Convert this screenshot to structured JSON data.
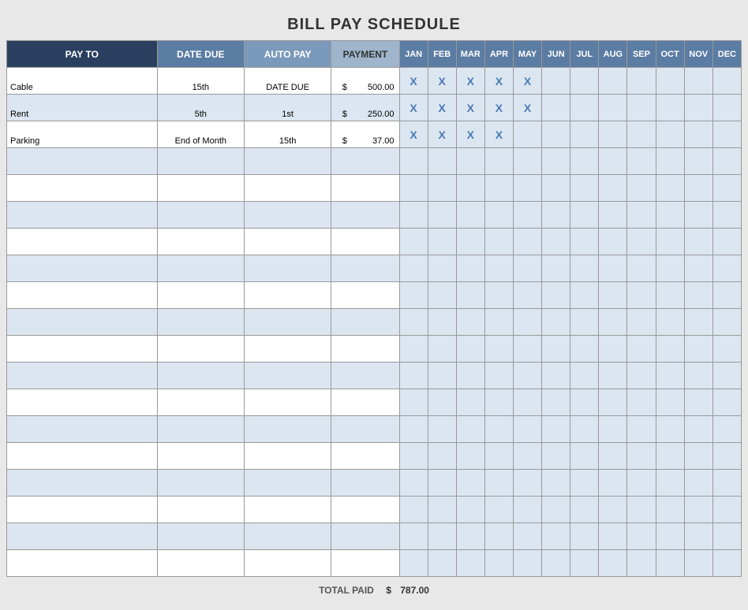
{
  "title": "BILL PAY SCHEDULE",
  "headers": {
    "payto": "PAY TO",
    "datedue": "DATE DUE",
    "autopay": "AUTO PAY",
    "payment": "PAYMENT",
    "months": [
      "JAN",
      "FEB",
      "MAR",
      "APR",
      "MAY",
      "JUN",
      "JUL",
      "AUG",
      "SEP",
      "OCT",
      "NOV",
      "DEC"
    ]
  },
  "currency_symbol": "$",
  "rows": [
    {
      "payto": "Cable",
      "datedue": "15th",
      "autopay": "DATE DUE",
      "payment": "500.00",
      "months": [
        "X",
        "X",
        "X",
        "X",
        "X",
        "",
        "",
        "",
        "",
        "",
        "",
        ""
      ]
    },
    {
      "payto": "Rent",
      "datedue": "5th",
      "autopay": "1st",
      "payment": "250.00",
      "months": [
        "X",
        "X",
        "X",
        "X",
        "X",
        "",
        "",
        "",
        "",
        "",
        "",
        ""
      ]
    },
    {
      "payto": "Parking",
      "datedue": "End of Month",
      "autopay": "15th",
      "payment": "37.00",
      "months": [
        "X",
        "X",
        "X",
        "X",
        "",
        "",
        "",
        "",
        "",
        "",
        "",
        ""
      ]
    },
    {
      "payto": "",
      "datedue": "",
      "autopay": "",
      "payment": "",
      "months": [
        "",
        "",
        "",
        "",
        "",
        "",
        "",
        "",
        "",
        "",
        "",
        ""
      ]
    },
    {
      "payto": "",
      "datedue": "",
      "autopay": "",
      "payment": "",
      "months": [
        "",
        "",
        "",
        "",
        "",
        "",
        "",
        "",
        "",
        "",
        "",
        ""
      ]
    },
    {
      "payto": "",
      "datedue": "",
      "autopay": "",
      "payment": "",
      "months": [
        "",
        "",
        "",
        "",
        "",
        "",
        "",
        "",
        "",
        "",
        "",
        ""
      ]
    },
    {
      "payto": "",
      "datedue": "",
      "autopay": "",
      "payment": "",
      "months": [
        "",
        "",
        "",
        "",
        "",
        "",
        "",
        "",
        "",
        "",
        "",
        ""
      ]
    },
    {
      "payto": "",
      "datedue": "",
      "autopay": "",
      "payment": "",
      "months": [
        "",
        "",
        "",
        "",
        "",
        "",
        "",
        "",
        "",
        "",
        "",
        ""
      ]
    },
    {
      "payto": "",
      "datedue": "",
      "autopay": "",
      "payment": "",
      "months": [
        "",
        "",
        "",
        "",
        "",
        "",
        "",
        "",
        "",
        "",
        "",
        ""
      ]
    },
    {
      "payto": "",
      "datedue": "",
      "autopay": "",
      "payment": "",
      "months": [
        "",
        "",
        "",
        "",
        "",
        "",
        "",
        "",
        "",
        "",
        "",
        ""
      ]
    },
    {
      "payto": "",
      "datedue": "",
      "autopay": "",
      "payment": "",
      "months": [
        "",
        "",
        "",
        "",
        "",
        "",
        "",
        "",
        "",
        "",
        "",
        ""
      ]
    },
    {
      "payto": "",
      "datedue": "",
      "autopay": "",
      "payment": "",
      "months": [
        "",
        "",
        "",
        "",
        "",
        "",
        "",
        "",
        "",
        "",
        "",
        ""
      ]
    },
    {
      "payto": "",
      "datedue": "",
      "autopay": "",
      "payment": "",
      "months": [
        "",
        "",
        "",
        "",
        "",
        "",
        "",
        "",
        "",
        "",
        "",
        ""
      ]
    },
    {
      "payto": "",
      "datedue": "",
      "autopay": "",
      "payment": "",
      "months": [
        "",
        "",
        "",
        "",
        "",
        "",
        "",
        "",
        "",
        "",
        "",
        ""
      ]
    },
    {
      "payto": "",
      "datedue": "",
      "autopay": "",
      "payment": "",
      "months": [
        "",
        "",
        "",
        "",
        "",
        "",
        "",
        "",
        "",
        "",
        "",
        ""
      ]
    },
    {
      "payto": "",
      "datedue": "",
      "autopay": "",
      "payment": "",
      "months": [
        "",
        "",
        "",
        "",
        "",
        "",
        "",
        "",
        "",
        "",
        "",
        ""
      ]
    },
    {
      "payto": "",
      "datedue": "",
      "autopay": "",
      "payment": "",
      "months": [
        "",
        "",
        "",
        "",
        "",
        "",
        "",
        "",
        "",
        "",
        "",
        ""
      ]
    },
    {
      "payto": "",
      "datedue": "",
      "autopay": "",
      "payment": "",
      "months": [
        "",
        "",
        "",
        "",
        "",
        "",
        "",
        "",
        "",
        "",
        "",
        ""
      ]
    },
    {
      "payto": "",
      "datedue": "",
      "autopay": "",
      "payment": "",
      "months": [
        "",
        "",
        "",
        "",
        "",
        "",
        "",
        "",
        "",
        "",
        "",
        ""
      ]
    }
  ],
  "footer": {
    "label": "TOTAL PAID",
    "currency": "$",
    "amount": "787.00"
  }
}
